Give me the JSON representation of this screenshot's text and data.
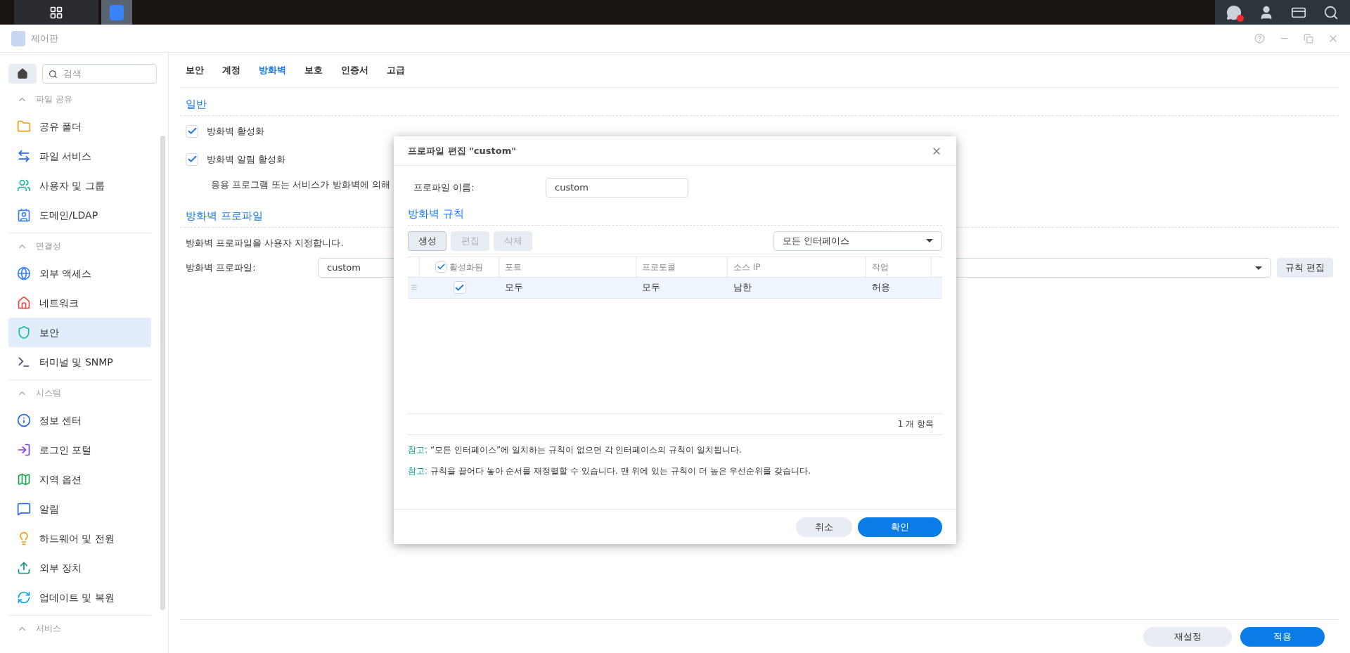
{
  "window": {
    "title": "제어판"
  },
  "sidebar": {
    "search": {
      "placeholder": "검색"
    },
    "sections": [
      {
        "title": "파일 공유",
        "expanded": true,
        "items": [
          {
            "label": "공유 폴더",
            "selected": false
          },
          {
            "label": "파일 서비스",
            "selected": false
          },
          {
            "label": "사용자 및 그룹",
            "selected": false
          },
          {
            "label": "도메인/LDAP",
            "selected": false
          }
        ]
      },
      {
        "title": "연결성",
        "expanded": true,
        "items": [
          {
            "label": "외부 액세스",
            "selected": false
          },
          {
            "label": "네트워크",
            "selected": false
          },
          {
            "label": "보안",
            "selected": true
          },
          {
            "label": "터미널 및 SNMP",
            "selected": false
          }
        ]
      },
      {
        "title": "시스템",
        "expanded": true,
        "items": [
          {
            "label": "정보 센터",
            "selected": false
          },
          {
            "label": "로그인 포털",
            "selected": false
          },
          {
            "label": "지역 옵션",
            "selected": false
          },
          {
            "label": "알림",
            "selected": false
          },
          {
            "label": "하드웨어 및 전원",
            "selected": false
          },
          {
            "label": "외부 장치",
            "selected": false
          },
          {
            "label": "업데이트 및 복원",
            "selected": false
          }
        ]
      },
      {
        "title": "서비스",
        "expanded": true
      }
    ]
  },
  "tabs": [
    {
      "label": "보안",
      "selected": false
    },
    {
      "label": "계정",
      "selected": false
    },
    {
      "label": "방화벽",
      "selected": true
    },
    {
      "label": "보호",
      "selected": false
    },
    {
      "label": "인증서",
      "selected": false
    },
    {
      "label": "고급",
      "selected": false
    }
  ],
  "general": {
    "title": "일반",
    "checkboxes": [
      {
        "label": "방화벽 활성화",
        "checked": true
      },
      {
        "label": "방화벽 알림 활성화",
        "checked": true
      }
    ],
    "note": "응용 프로그램 또는 서비스가 방화벽에 의해"
  },
  "profile": {
    "title": "방화벽 프로파일",
    "description": "방화벽 프로파일을 사용자 지정합니다.",
    "field_label": "방화벽 프로파일:",
    "value": "custom",
    "edit_button": "규칙 편집"
  },
  "dialog": {
    "title": "프로파일 편집 \"custom\"",
    "name_label": "프로파일 이름:",
    "name_value": "custom",
    "rules_title": "방화벽 규칙",
    "toolbar": [
      {
        "label": "생성",
        "disabled": false
      },
      {
        "label": "편집",
        "disabled": true
      },
      {
        "label": "삭제",
        "disabled": true
      }
    ],
    "interface": "모든 인터페이스",
    "columns": {
      "enabled": "활성화됨",
      "all_checked": true,
      "port": "포트",
      "protocol": "프로토콜",
      "source_ip": "소스 IP",
      "action": "작업"
    },
    "rows": [
      {
        "enabled": true,
        "port": "모두",
        "protocol": "모두",
        "source_ip": "남한",
        "action": "허용",
        "selected": true
      }
    ],
    "count": "1 개 항목",
    "notes": [
      {
        "prefix": "참고:",
        "text": "“모든 인터페이스”에 일치하는 규칙이 없으면 각 인터페이스의 규칙이 일치됩니다."
      },
      {
        "prefix": "참고:",
        "text": "규칙을 끌어다 놓아 순서를 재정렬할 수 있습니다. 맨 위에 있는 규칙이 더 높은 우선순위를 갖습니다."
      }
    ],
    "cancel": "취소",
    "ok": "확인"
  },
  "footer": {
    "reset": "재설정",
    "apply": "적용"
  }
}
